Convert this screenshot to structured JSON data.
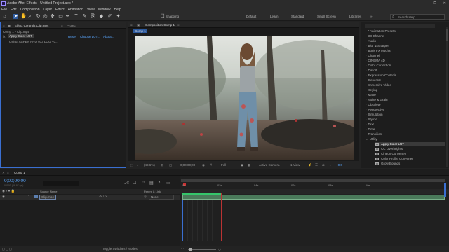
{
  "titlebar": {
    "title": "Adobe After Effects - Untitled Project.aep *",
    "min": "—",
    "max": "❐",
    "close": "✕"
  },
  "menu": [
    "File",
    "Edit",
    "Composition",
    "Layer",
    "Effect",
    "Animation",
    "View",
    "Window",
    "Help"
  ],
  "toolbar": {
    "snapping": "Snapping",
    "workspaces": [
      "Default",
      "Learn",
      "Standard",
      "Small Screen",
      "Libraries"
    ],
    "search_placeholder": "Search Help"
  },
  "effect_controls": {
    "tab_label": "Effect Controls Clip.mp4",
    "project_tab": "Project",
    "breadcrumb": "Comp 1 • Clip.mp4",
    "effect_name": "Apply Color LUT",
    "reset": "Reset",
    "choose_lut": "Choose LUT...",
    "about": "About...",
    "using": "Using: ASPEN PRO 013 LOG - 0..."
  },
  "viewer": {
    "tab_label": "Composition Comp 1",
    "comp_chip": "Comp 1",
    "zoom": "(48.6%)",
    "timecode": "0;00;00;00",
    "resolution": "Full",
    "camera": "Active Camera",
    "views": "1 View",
    "exposure": "+0.0"
  },
  "effects_presets": {
    "items": [
      "* Animation Presets",
      "3D Channel",
      "Audio",
      "Blur & Sharpen",
      "Boris FX Mocha",
      "Channel",
      "CINEMA 4D",
      "Color Correction",
      "Distort",
      "Expression Controls",
      "Generate",
      "Immersive Video",
      "Keying",
      "Matte",
      "Noise & Grain",
      "Obsolete",
      "Perspective",
      "Simulation",
      "Stylize",
      "Text",
      "Time",
      "Transition",
      "Utility"
    ],
    "utility_children": [
      "Apply Color LUT",
      "CC Overbrights",
      "Cineon Converter",
      "Color Profile Converter",
      "Grow Bounds"
    ]
  },
  "timeline": {
    "tab_label": "Comp 1",
    "timecode": "0;00;00;00",
    "fps": "00000 (29.97 fps)",
    "col_source": "Source Name",
    "col_parent": "Parent & Link",
    "layer_index": "1",
    "layer_name": "Clip.mp4",
    "parent_value": "None",
    "ruler": [
      "0s",
      "02s",
      "04s",
      "06s",
      "08s",
      "10s"
    ],
    "toggle_label": "Toggle Switches / Modes"
  }
}
